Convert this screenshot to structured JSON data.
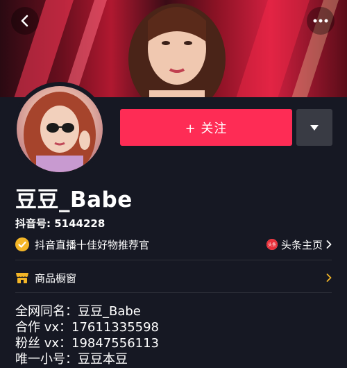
{
  "header": {
    "back_icon": "back-arrow-icon",
    "more_icon": "more-dots-icon"
  },
  "profile": {
    "follow_label": "+ 关注",
    "nickname": "豆豆_Babe",
    "douyin_id": "抖音号: 5144228",
    "verification": "抖音直播十佳好物推荐官",
    "toutiao_logo_text": "头条",
    "toutiao_link": "头条主页"
  },
  "shop": {
    "label": "商品橱窗"
  },
  "bio": {
    "lines": [
      "全网同名：豆豆_Babe",
      "合作 vx：17611335598",
      "粉丝 vx：19847556113",
      "唯一小号：豆豆本豆"
    ]
  },
  "colors": {
    "background": "#161823",
    "follow_button": "#fe2c55",
    "verified_badge": "#f4b627",
    "shop_icon": "#f4b627",
    "toutiao_red": "#e8303a"
  }
}
